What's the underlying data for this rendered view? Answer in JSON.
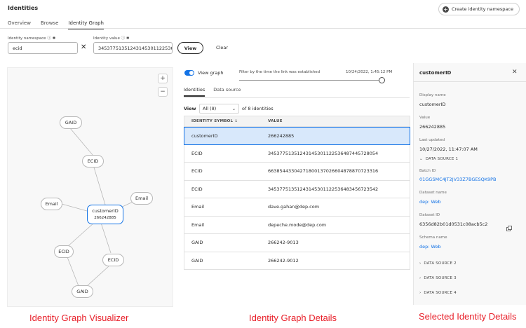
{
  "header": {
    "title": "Identities",
    "create_label": "Create identity namespace"
  },
  "tabs": [
    "Overview",
    "Browse",
    "Identity Graph"
  ],
  "filters": {
    "namespace_label": "Identity namespace",
    "namespace_value": "ecid",
    "value_label": "Identity value",
    "value_value": "34537751351243145301122536485…",
    "view_label": "View",
    "clear_label": "Clear"
  },
  "graph_controls": {
    "view_graph_label": "View graph",
    "filter_text": "Filter by the time the link was established",
    "filter_date": "10/24/2022, 1:45:12 PM",
    "slider_fraction": 1.0
  },
  "graph": {
    "center": {
      "label": "customerID",
      "value": "266242885"
    },
    "nodes": [
      "GAID",
      "ECID",
      "Email",
      "Email",
      "ECID",
      "ECID",
      "GAID"
    ]
  },
  "details": {
    "tabs": [
      "Identities",
      "Data source"
    ],
    "view_label": "View",
    "view_select": "All (8)",
    "count_text": "of 8 identities",
    "columns": [
      "IDENTITY SYMBOL",
      "VALUE"
    ],
    "rows": [
      {
        "symbol": "customerID",
        "value": "266242885"
      },
      {
        "symbol": "ECID",
        "value": "34537751351243145301122536487445728054"
      },
      {
        "symbol": "ECID",
        "value": "66385443304271800137026604878870723316"
      },
      {
        "symbol": "ECID",
        "value": "34537751351243145301122536483456723542"
      },
      {
        "symbol": "Email",
        "value": "dave.gahan@dep.com"
      },
      {
        "symbol": "Email",
        "value": "depeche.mode@dep.com"
      },
      {
        "symbol": "GAID",
        "value": "266242-9013"
      },
      {
        "symbol": "GAID",
        "value": "266242-9012"
      }
    ]
  },
  "selected": {
    "title": "customerID",
    "display_name_label": "Display name",
    "display_name": "customerID",
    "value_label": "Value",
    "value": "266242885",
    "last_updated_label": "Last updated",
    "last_updated": "10/27/2022, 11:47:07 AM",
    "ds1": "DATA SOURCE 1",
    "batch_id_label": "Batch ID",
    "batch_id": "01GGSMC4JT2JV33Z7BGESQK9PB",
    "dataset_name_label": "Dataset name",
    "dataset_name": "dep: Web",
    "dataset_id_label": "Dataset ID",
    "dataset_id": "6356d82b01d0531c08acb5c2",
    "schema_name_label": "Schema name",
    "schema_name": "dep: Web",
    "ds2": "DATA SOURCE 2",
    "ds3": "DATA SOURCE 3",
    "ds4": "DATA SOURCE 4"
  },
  "captions": {
    "left": "Identity Graph Visualizer",
    "middle": "Identity Graph Details",
    "right": "Selected Identity Details"
  },
  "colors": {
    "accent": "#1473e6",
    "caption": "#e8202a"
  }
}
